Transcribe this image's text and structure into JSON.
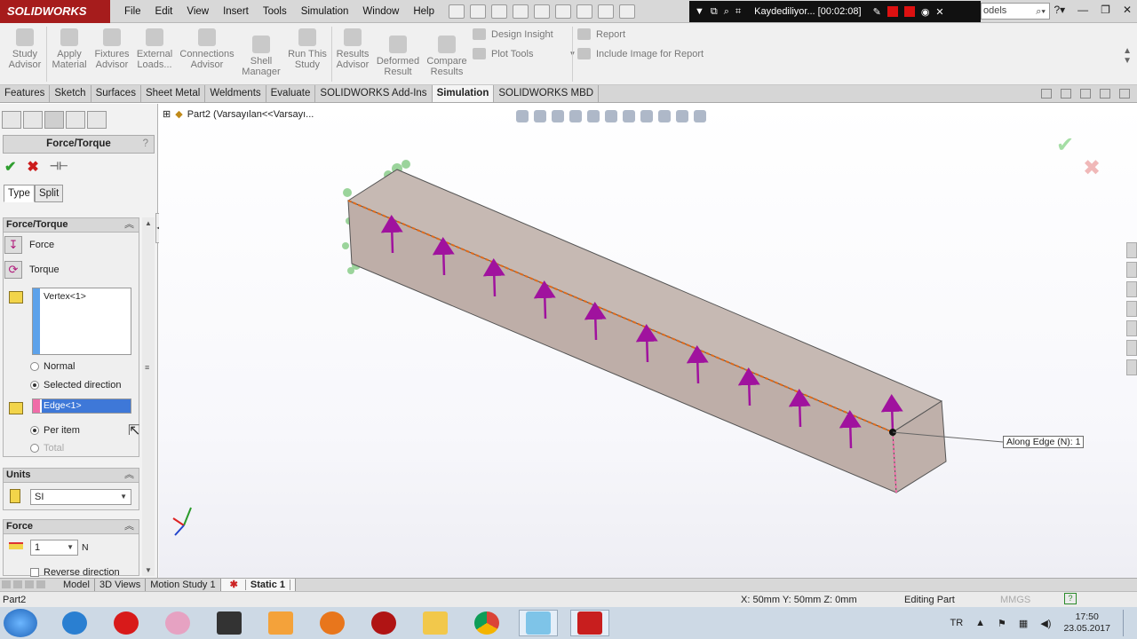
{
  "app": {
    "logo": "SOLIDWORKS"
  },
  "menu": [
    "File",
    "Edit",
    "View",
    "Insert",
    "Tools",
    "Simulation",
    "Window",
    "Help"
  ],
  "recorder": {
    "text": "Kaydediliyor... [00:02:08]"
  },
  "search": {
    "value": "odels"
  },
  "ribbon": {
    "buttons": [
      {
        "label1": "Study",
        "label2": "Advisor"
      },
      {
        "label1": "Apply",
        "label2": "Material"
      },
      {
        "label1": "Fixtures",
        "label2": "Advisor"
      },
      {
        "label1": "External",
        "label2": "Loads..."
      },
      {
        "label1": "Connections",
        "label2": "Advisor"
      },
      {
        "label1": "Shell",
        "label2": "Manager"
      },
      {
        "label1": "Run This",
        "label2": "Study"
      },
      {
        "label1": "Results",
        "label2": "Advisor"
      },
      {
        "label1": "Deformed",
        "label2": "Result"
      },
      {
        "label1": "Compare",
        "label2": "Results"
      }
    ],
    "design_insight": "Design Insight",
    "plot_tools": "Plot Tools",
    "report": "Report",
    "include_image": "Include Image for Report"
  },
  "command_tabs": [
    "Features",
    "Sketch",
    "Surfaces",
    "Sheet Metal",
    "Weldments",
    "Evaluate",
    "SOLIDWORKS Add-Ins",
    "Simulation",
    "SOLIDWORKS MBD"
  ],
  "active_tab": "Simulation",
  "property_manager": {
    "title": "Force/Torque",
    "help": "?",
    "tabs": [
      "Type",
      "Split"
    ],
    "section_force_torque": "Force/Torque",
    "force_option": "Force",
    "torque_option": "Torque",
    "selection_item": "Vertex<1>",
    "normal": "Normal",
    "selected_direction": "Selected direction",
    "direction_reference": "Edge<1>",
    "per_item": "Per item",
    "total": "Total",
    "units_section": "Units",
    "units_value": "SI",
    "force_section": "Force",
    "force_value": "1",
    "force_unit": "N",
    "reverse_direction": "Reverse direction"
  },
  "viewport": {
    "breadcrumb": "Part2  (Varsayılan<<Varsayı...",
    "callout": "Along Edge (N): 1"
  },
  "bottom_tabs": [
    "Model",
    "3D Views",
    "Motion Study 1",
    "Static 1"
  ],
  "status": {
    "doc": "Part2",
    "coords": "X: 50mm Y: 50mm Z: 0mm",
    "mode": "Editing Part",
    "units": "MMGS"
  },
  "taskbar": {
    "lang": "TR",
    "time": "17:50",
    "date": "23.05.2017"
  },
  "colors": {
    "accent": "#a61c1c",
    "arrow": "#a0129e",
    "model": "#c8bab4",
    "edge_sel": "#e06a1a"
  }
}
